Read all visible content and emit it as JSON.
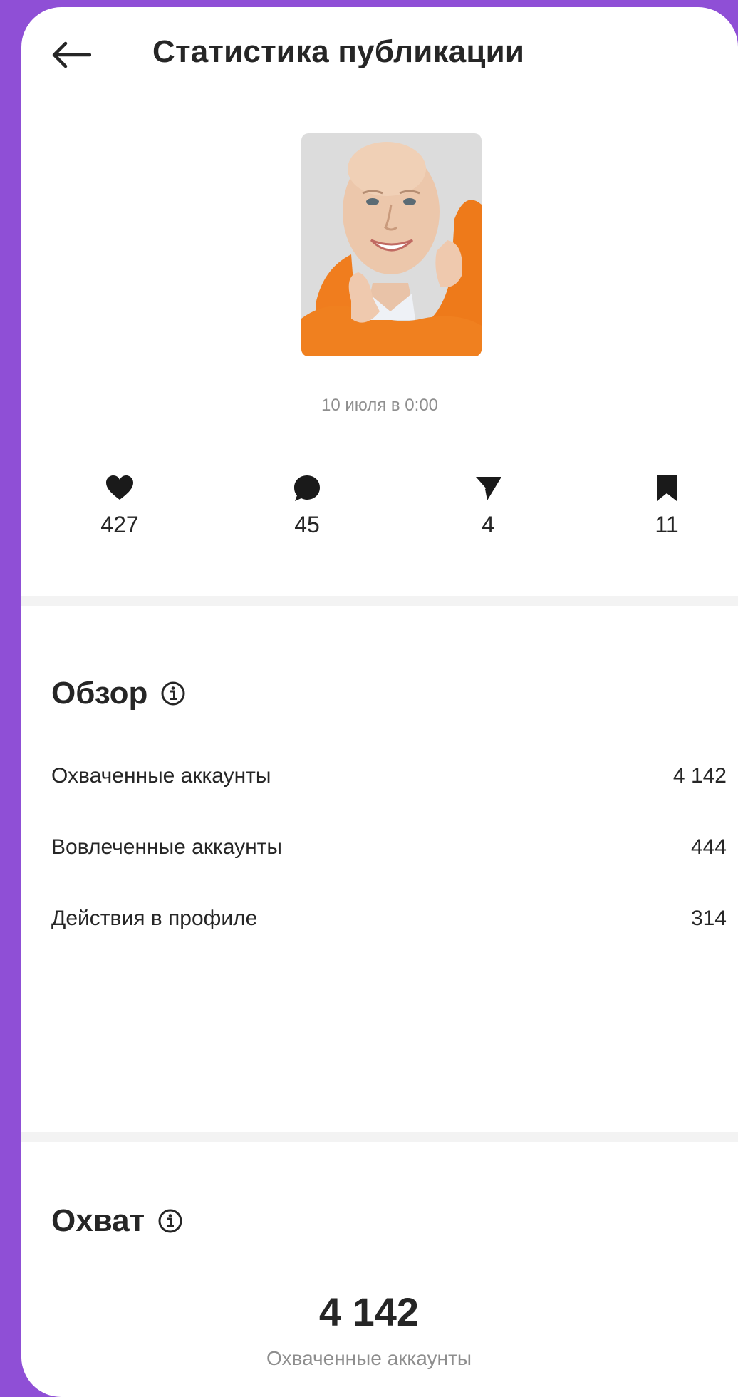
{
  "header": {
    "title": "Статистика публикации",
    "back_icon": "arrow-left-icon"
  },
  "post": {
    "date": "10 июля в 0:00"
  },
  "metrics": [
    {
      "icon": "heart-icon",
      "value": "427"
    },
    {
      "icon": "comment-icon",
      "value": "45"
    },
    {
      "icon": "send-icon",
      "value": "4"
    },
    {
      "icon": "bookmark-icon",
      "value": "11"
    }
  ],
  "overview": {
    "title": "Обзор",
    "rows": [
      {
        "label": "Охваченные аккаунты",
        "value": "4 142"
      },
      {
        "label": "Вовлеченные аккаунты",
        "value": "444"
      },
      {
        "label": "Действия в профиле",
        "value": "314"
      }
    ]
  },
  "reach": {
    "title": "Охват",
    "value": "4 142",
    "label": "Охваченные аккаунты"
  },
  "colors": {
    "frame": "#8f4fd6",
    "card": "#ffffff",
    "text": "#262626",
    "muted": "#8e8e8e",
    "divider": "#f3f3f3"
  }
}
